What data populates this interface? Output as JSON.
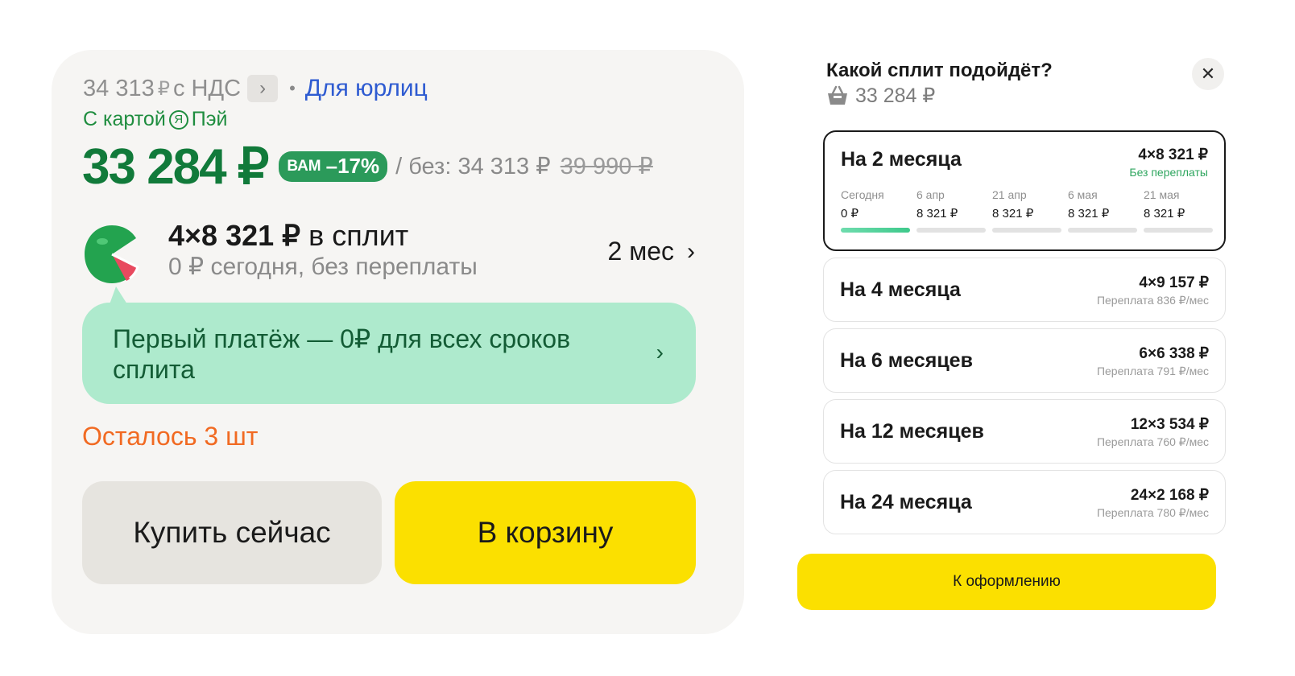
{
  "product": {
    "vat_price": "34 313",
    "vat_currency": "₽",
    "vat_label": "с НДС",
    "vat_chevron": "›",
    "separator": "•",
    "legal_link": "Для юрлиц",
    "card_prefix": "С картой",
    "card_logo": "Я",
    "card_suffix": "Пэй",
    "price_main": "33 284 ₽",
    "discount_prefix": "ВАМ",
    "discount_value": "–17%",
    "price_without": "/ без: 34 313 ₽",
    "price_old": "39 990 ₽",
    "split_amount": "4×8 321 ₽",
    "split_suffix": "в сплит",
    "split_subtitle": "0 ₽ сегодня, без переплаты",
    "split_term": "2 мес",
    "split_term_chevron": "›",
    "promo_text": "Первый платёж — 0₽ для всех сроков сплита",
    "promo_chevron": "›",
    "stock": "Осталось 3 шт",
    "buy_now": "Купить сейчас",
    "add_to_cart": "В корзину",
    "icon_names": [
      "chevron-right-icon",
      "ya-pay-logo",
      "watermelon-split-icon"
    ]
  },
  "split_panel": {
    "title": "Какой сплит подойдёт?",
    "total": "33 284 ₽",
    "close_glyph": "✕",
    "plans": [
      {
        "name": "На 2 месяца",
        "amount": "4×8 321 ₽",
        "note": "Без переплаты",
        "schedule": [
          {
            "date": "Сегодня",
            "amount": "0 ₽",
            "paid": true
          },
          {
            "date": "6 апр",
            "amount": "8 321 ₽",
            "paid": false
          },
          {
            "date": "21 апр",
            "amount": "8 321 ₽",
            "paid": false
          },
          {
            "date": "6 мая",
            "amount": "8 321 ₽",
            "paid": false
          },
          {
            "date": "21 мая",
            "amount": "8 321 ₽",
            "paid": false
          }
        ]
      },
      {
        "name": "На 4 месяца",
        "amount": "4×9 157 ₽",
        "note": "Переплата 836 ₽/мес"
      },
      {
        "name": "На 6 месяцев",
        "amount": "6×6 338 ₽",
        "note": "Переплата 791 ₽/мес"
      },
      {
        "name": "На 12 месяцев",
        "amount": "12×3 534 ₽",
        "note": "Переплата 760 ₽/мес"
      },
      {
        "name": "На 24 месяца",
        "amount": "24×2 168 ₽",
        "note": "Переплата 780 ₽/мес"
      }
    ],
    "checkout": "К оформлению"
  },
  "colors": {
    "price_green": "#117a3a",
    "badge_green": "#2b9a5a",
    "promo_bg": "#aeeacd",
    "stock_orange": "#f16a22",
    "yellow_button": "#fbe000",
    "link_blue": "#2e5bd1"
  }
}
